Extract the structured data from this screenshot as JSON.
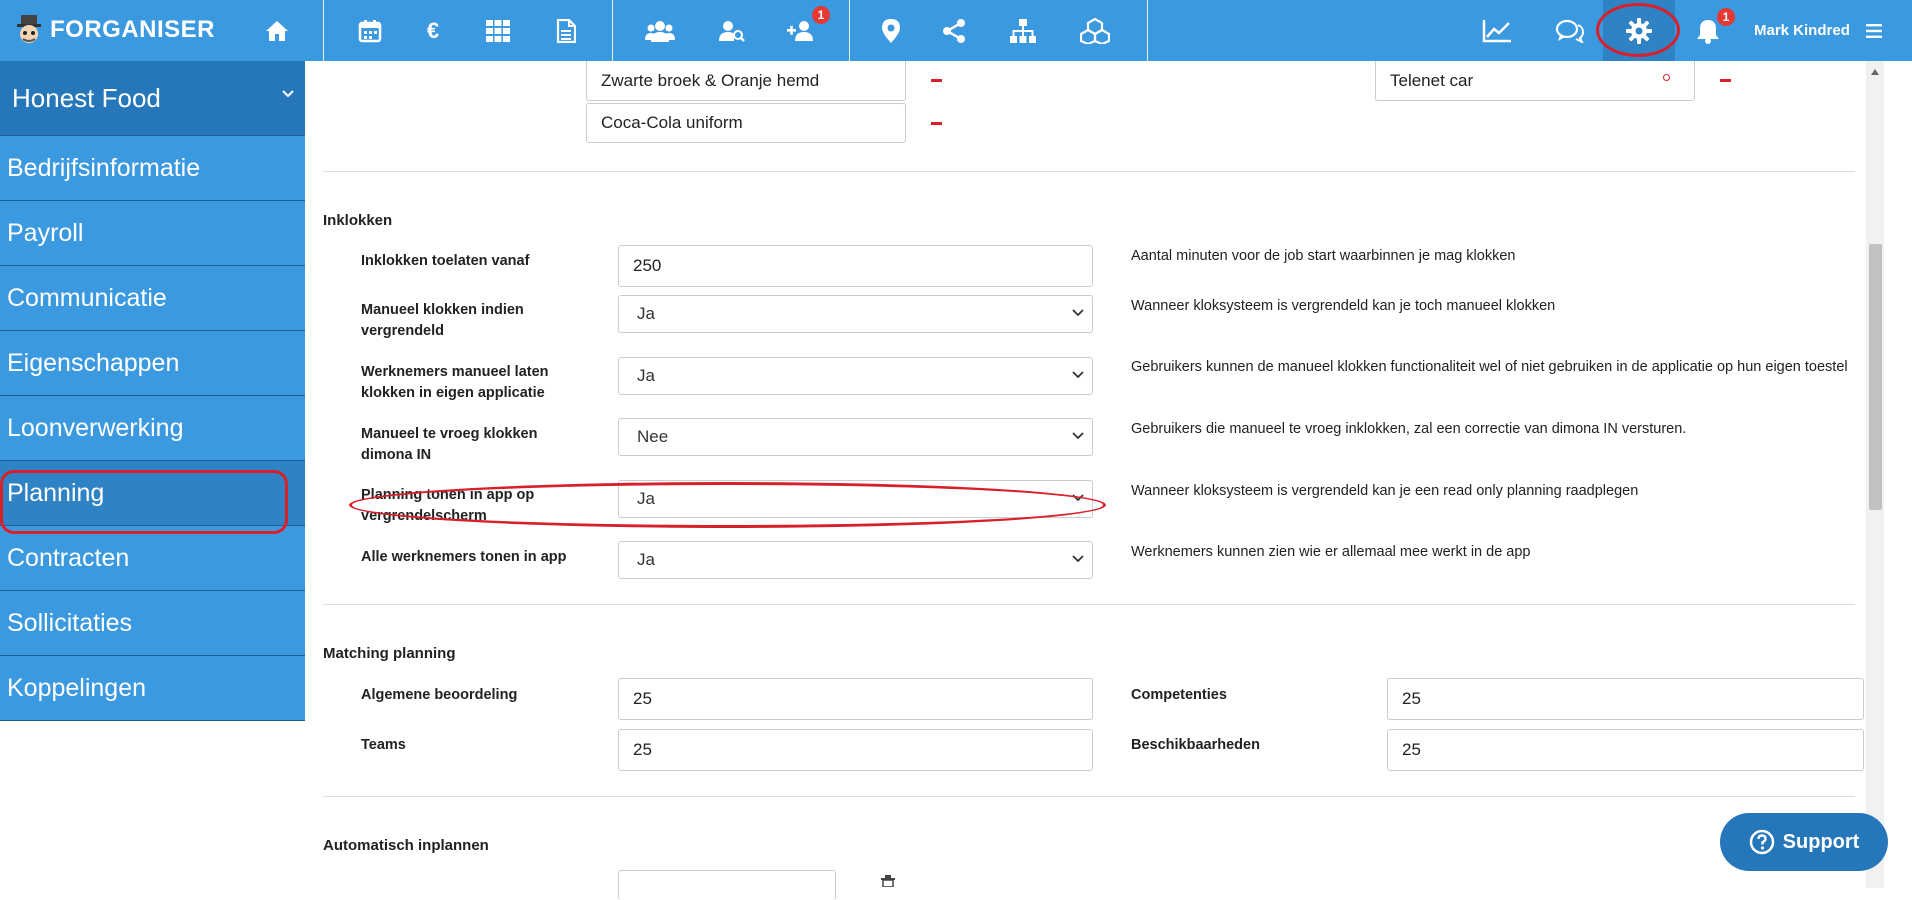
{
  "header": {
    "logo_text": "FORGANISER",
    "notifications_badge": "1",
    "add_user_badge": "1",
    "user_name": "Mark Kindred",
    "icons": [
      "home-icon",
      "calendar-icon",
      "euro-icon",
      "grid-icon",
      "document-icon",
      "users-icon",
      "user-search-icon",
      "user-add-icon",
      "location-icon",
      "share-icon",
      "sitemap-icon",
      "cubes-icon",
      "chart-line-icon",
      "chat-icon",
      "gear-icon",
      "bell-icon",
      "menu-icon"
    ]
  },
  "sidebar": {
    "company": "Honest Food",
    "items": [
      "Bedrijfsinformatie",
      "Payroll",
      "Communicatie",
      "Eigenschappen",
      "Loonverwerking",
      "Planning",
      "Contracten",
      "Sollicitaties",
      "Koppelingen"
    ],
    "active": "Planning"
  },
  "top_fields": {
    "left": [
      "Zwarte broek & Oranje hemd",
      "Coca-Cola uniform"
    ],
    "right": "Telenet car"
  },
  "inklokken": {
    "title": "Inklokken",
    "rows": [
      {
        "label": "Inklokken toelaten vanaf",
        "value": "250",
        "desc": "Aantal minuten voor de job start waarbinnen je mag klokken"
      },
      {
        "label": "Manueel klokken indien vergrendeld",
        "value": "Ja",
        "desc": "Wanneer kloksysteem is vergrendeld kan je toch manueel klokken"
      },
      {
        "label": "Werknemers manueel laten klokken in eigen applicatie",
        "value": "Ja",
        "desc": "Gebruikers kunnen de manueel klokken functionaliteit wel of niet gebruiken in de applicatie op hun eigen toestel"
      },
      {
        "label": "Manueel te vroeg klokken dimona IN",
        "value": "Nee",
        "desc": "Gebruikers die manueel te vroeg inklokken, zal een correctie van dimona IN versturen."
      },
      {
        "label": "Planning tonen in app op vergrendelscherm",
        "value": "Ja",
        "desc": "Wanneer kloksysteem is vergrendeld kan je een read only planning raadplegen"
      },
      {
        "label": "Alle werknemers tonen in app",
        "value": "Ja",
        "desc": "Werknemers kunnen zien wie er allemaal mee werkt in de app"
      }
    ]
  },
  "matching": {
    "title": "Matching planning",
    "fields": [
      {
        "label": "Algemene beoordeling",
        "value": "25"
      },
      {
        "label": "Competenties",
        "value": "25"
      },
      {
        "label": "Teams",
        "value": "25"
      },
      {
        "label": "Beschikbaarheden",
        "value": "25"
      }
    ]
  },
  "auto": {
    "title": "Automatisch inplannen"
  },
  "support_label": "Support",
  "colors": {
    "brand": "#3b99e0",
    "dark": "#2676ba",
    "highlight": "#d8202a"
  }
}
